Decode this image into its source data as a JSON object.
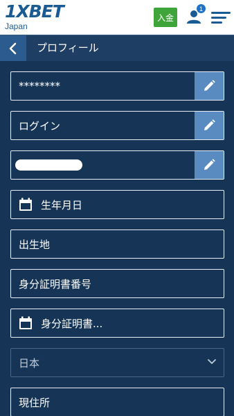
{
  "header": {
    "logo_text": "1XBET",
    "region": "Japan",
    "deposit_label": "入金",
    "notification_count": "1",
    "icons": [
      "user-icon",
      "menu-icon"
    ],
    "brand_color": "#1a5b94",
    "deposit_color": "#3fa53a"
  },
  "titlebar": {
    "title": "プロフィール",
    "back_icon": "chevron-left-icon"
  },
  "form": {
    "password": {
      "value": "********",
      "icon": "pencil-icon"
    },
    "login": {
      "value": "ログイン",
      "icon": "pencil-icon"
    },
    "masked_field": {
      "icon": "pencil-icon"
    },
    "birth_date": {
      "placeholder": "生年月日",
      "icon": "calendar-icon"
    },
    "birthplace": {
      "placeholder": "出生地"
    },
    "id_number": {
      "placeholder": "身分証明書番号"
    },
    "id_date": {
      "placeholder": "身分証明書...",
      "icon": "calendar-icon"
    },
    "country": {
      "value": "日本",
      "icon": "chevron-down-icon"
    },
    "address": {
      "placeholder": "現住所"
    }
  }
}
